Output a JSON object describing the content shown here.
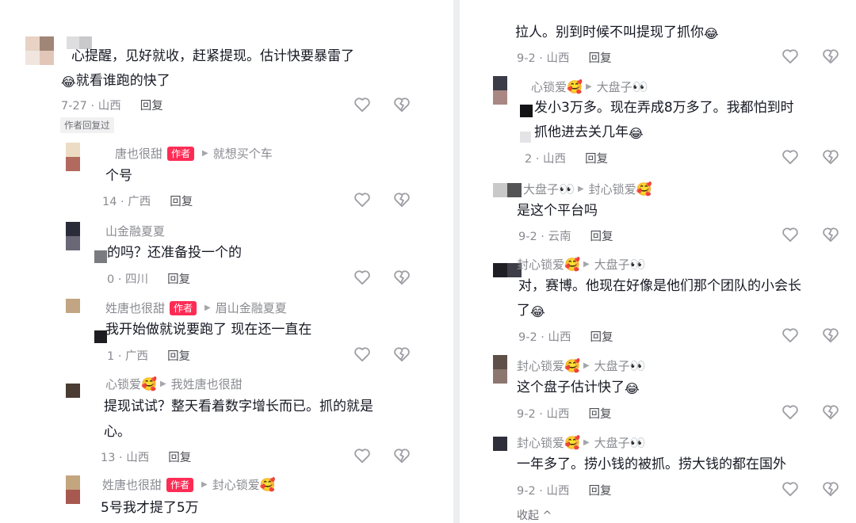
{
  "left": {
    "comments": [
      {
        "id": "L1",
        "level": 0,
        "name": "",
        "author_tag": "",
        "reply_to": "",
        "text_lines": [
          [
            "心提醒，见好就收，赶紧提现。估计快要暴雷了"
          ],
          [
            "[emoji]",
            "就看谁跑的快了"
          ]
        ],
        "date_loc": "7-27 · 山西",
        "reply": "回复",
        "author_replied": "作者回复过"
      },
      {
        "id": "L2",
        "level": 1,
        "name": "唐也很甜",
        "author_tag": "作者",
        "reply_to": "就想买个车",
        "text_lines": [
          [
            "个号"
          ]
        ],
        "date_loc": "14 · 广西",
        "reply": "回复"
      },
      {
        "id": "L3",
        "level": 1,
        "name": "山金融夏夏",
        "author_tag": "",
        "reply_to": "",
        "text_lines": [
          [
            "的吗？还准备投一个的"
          ]
        ],
        "date_loc": "0 · 四川",
        "reply": "回复"
      },
      {
        "id": "L4",
        "level": 1,
        "name": "姓唐也很甜",
        "author_tag": "作者",
        "reply_to": "眉山金融夏夏",
        "text_lines": [
          [
            "我开始做就说要跑了 现在还一直在"
          ]
        ],
        "date_loc": "1 · 广西",
        "reply": "回复"
      },
      {
        "id": "L5",
        "level": 1,
        "name": "心锁爱",
        "author_tag": "",
        "reply_to": "我姓唐也很甜",
        "text_lines": [
          [
            "提现试试？整天看着数字增长而已。抓的就是"
          ],
          [
            "心。"
          ]
        ],
        "date_loc": "13 · 山西",
        "reply": "回复"
      },
      {
        "id": "L6",
        "level": 1,
        "name": "姓唐也很甜",
        "author_tag": "作者",
        "reply_to": "封心锁爱",
        "text_lines": [
          [
            "5号我才提了5万"
          ]
        ],
        "date_loc": "",
        "reply": ""
      }
    ]
  },
  "right": {
    "top_fragment": "",
    "comments": [
      {
        "id": "R1",
        "name": "",
        "reply_to": "",
        "text_lines": [
          [
            "拉人。别到时候不叫提现了抓你",
            "[emoji]"
          ]
        ],
        "date_loc": "9-2 · 山西",
        "reply": "回复"
      },
      {
        "id": "R2",
        "name": "心锁爱",
        "reply_to": "大盘子",
        "text_lines": [
          [
            "发小3万多。现在弄成8万多了。我都怕到时"
          ],
          [
            "抓他进去关几年",
            "[emoji]"
          ]
        ],
        "date_loc": "2 · 山西",
        "reply": "回复"
      },
      {
        "id": "R3",
        "name": "大盘子",
        "reply_to": "封心锁爱",
        "text_lines": [
          [
            "是这个平台吗"
          ]
        ],
        "date_loc": "9-2 · 云南",
        "reply": "回复"
      },
      {
        "id": "R4",
        "name": "封心锁爱",
        "reply_to": "大盘子",
        "text_lines": [
          [
            "对，赛博。他现在好像是他们那个团队的小会长"
          ],
          [
            "了",
            "[emoji]"
          ]
        ],
        "date_loc": "9-2 · 山西",
        "reply": "回复"
      },
      {
        "id": "R5",
        "name": "封心锁爱",
        "reply_to": "大盘子",
        "text_lines": [
          [
            "这个盘子估计快了",
            "[emoji]"
          ]
        ],
        "date_loc": "9-2 · 山西",
        "reply": "回复"
      },
      {
        "id": "R6",
        "name": "封心锁爱",
        "reply_to": "大盘子",
        "text_lines": [
          [
            "一年多了。捞小钱的被抓。捞大钱的都在国外"
          ]
        ],
        "date_loc": "9-2 · 山西",
        "reply": "回复"
      }
    ],
    "collapse_label": "收起 ^"
  },
  "icons": {
    "like": "heart-outline-icon",
    "dislike": "broken-heart-icon",
    "emoji": "laughing-crying-emoji",
    "eyes": "eyes-emoji",
    "love": "smiling-hearts-emoji",
    "arrow": "reply-arrow-icon"
  },
  "colors": {
    "author_tag": "#fe2c55",
    "muted": "#8a8b91",
    "text": "#161823",
    "icon": "#9e9fa4"
  }
}
